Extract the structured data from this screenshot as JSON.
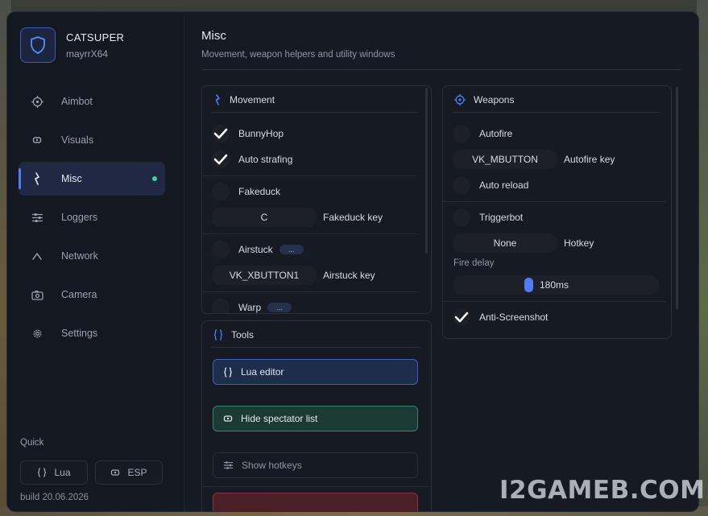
{
  "brand": {
    "name": "CATSUPER",
    "user": "mayrrX64"
  },
  "nav": [
    {
      "label": "Aimbot",
      "icon": "crosshair-icon"
    },
    {
      "label": "Visuals",
      "icon": "eye-icon"
    },
    {
      "label": "Misc",
      "icon": "lightning-icon",
      "active": true
    },
    {
      "label": "Loggers",
      "icon": "sliders-icon"
    },
    {
      "label": "Network",
      "icon": "wifi-icon"
    },
    {
      "label": "Camera",
      "icon": "camera-icon"
    },
    {
      "label": "Settings",
      "icon": "gear-icon"
    }
  ],
  "quick": {
    "title": "Quick",
    "lua_label": "Lua",
    "esp_label": "ESP"
  },
  "build": "build 20.06.2026",
  "page": {
    "title": "Misc",
    "subtitle": "Movement, weapon helpers and utility windows"
  },
  "movement": {
    "title": "Movement",
    "bunnyhop": {
      "label": "BunnyHop",
      "checked": true
    },
    "auto_strafing": {
      "label": "Auto strafing",
      "checked": true
    },
    "fakeduck": {
      "label": "Fakeduck",
      "checked": false
    },
    "fakeduck_key": {
      "value": "C",
      "label": "Fakeduck key"
    },
    "airstuck": {
      "label": "Airstuck",
      "checked": false,
      "pill": "..."
    },
    "airstuck_key": {
      "value": "VK_XBUTTON1",
      "label": "Airstuck key"
    },
    "warp": {
      "label": "Warp",
      "checked": false,
      "pill": "..."
    }
  },
  "weapons": {
    "title": "Weapons",
    "autofire": {
      "label": "Autofire",
      "checked": false
    },
    "autofire_key": {
      "value": "VK_MBUTTON",
      "label": "Autofire key"
    },
    "auto_reload": {
      "label": "Auto reload",
      "checked": false
    },
    "triggerbot": {
      "label": "Triggerbot",
      "checked": false
    },
    "hotkey": {
      "value": "None",
      "label": "Hotkey"
    },
    "fire_delay": {
      "label": "Fire delay",
      "value": "180ms"
    },
    "anti_screenshot": {
      "label": "Anti-Screenshot",
      "checked": true
    }
  },
  "tools": {
    "title": "Tools",
    "lua_editor": "Lua editor",
    "hide_spectator": "Hide spectator list",
    "show_hotkeys": "Show hotkeys"
  },
  "colors": {
    "accent": "#4f7cf2",
    "online": "#3fd3a0",
    "green": "#2f8a6d",
    "red": "#8a3342"
  },
  "watermark": "I2GAMEB.COM"
}
